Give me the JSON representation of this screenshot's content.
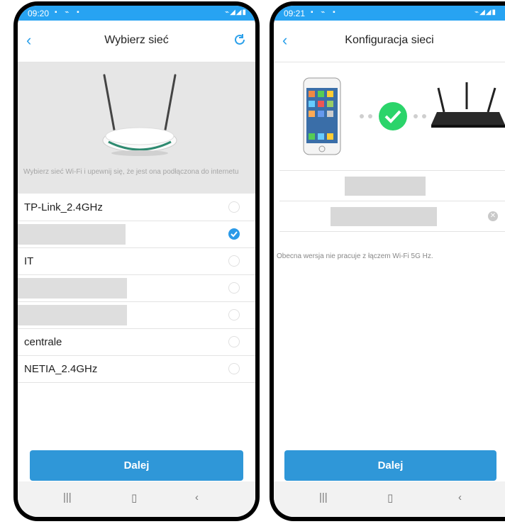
{
  "screens": [
    {
      "status_time": "09:20",
      "title": "Wybierz sieć",
      "hint": "Wybierz sieć Wi-Fi i upewnij się, że jest ona podłączona do internetu",
      "networks": [
        {
          "name": "TP-Link_2.4GHz",
          "selected": false,
          "redacted": false
        },
        {
          "name": "",
          "selected": true,
          "redacted": true
        },
        {
          "name": "IT",
          "selected": false,
          "redacted": false
        },
        {
          "name": "",
          "selected": false,
          "redacted": true
        },
        {
          "name": "",
          "selected": false,
          "redacted": true
        },
        {
          "name": "centrale",
          "selected": false,
          "redacted": false
        },
        {
          "name": "NETIA_2.4GHz",
          "selected": false,
          "redacted": false
        }
      ],
      "button": "Dalej"
    },
    {
      "status_time": "09:21",
      "title": "Konfiguracja sieci",
      "note": "Obecna wersja nie pracuje z łączem Wi-Fi 5G Hz.",
      "button": "Dalej"
    }
  ],
  "icons": {
    "back": "chevron-left-icon",
    "refresh": "refresh-icon",
    "recents": "recents-icon",
    "home": "home-icon",
    "back_nav": "back-icon",
    "success": "checkmark-icon"
  },
  "colors": {
    "accent": "#2ba0ea",
    "status_bar": "#27a3f2",
    "button": "#2f97d8",
    "success": "#2bd46a"
  }
}
